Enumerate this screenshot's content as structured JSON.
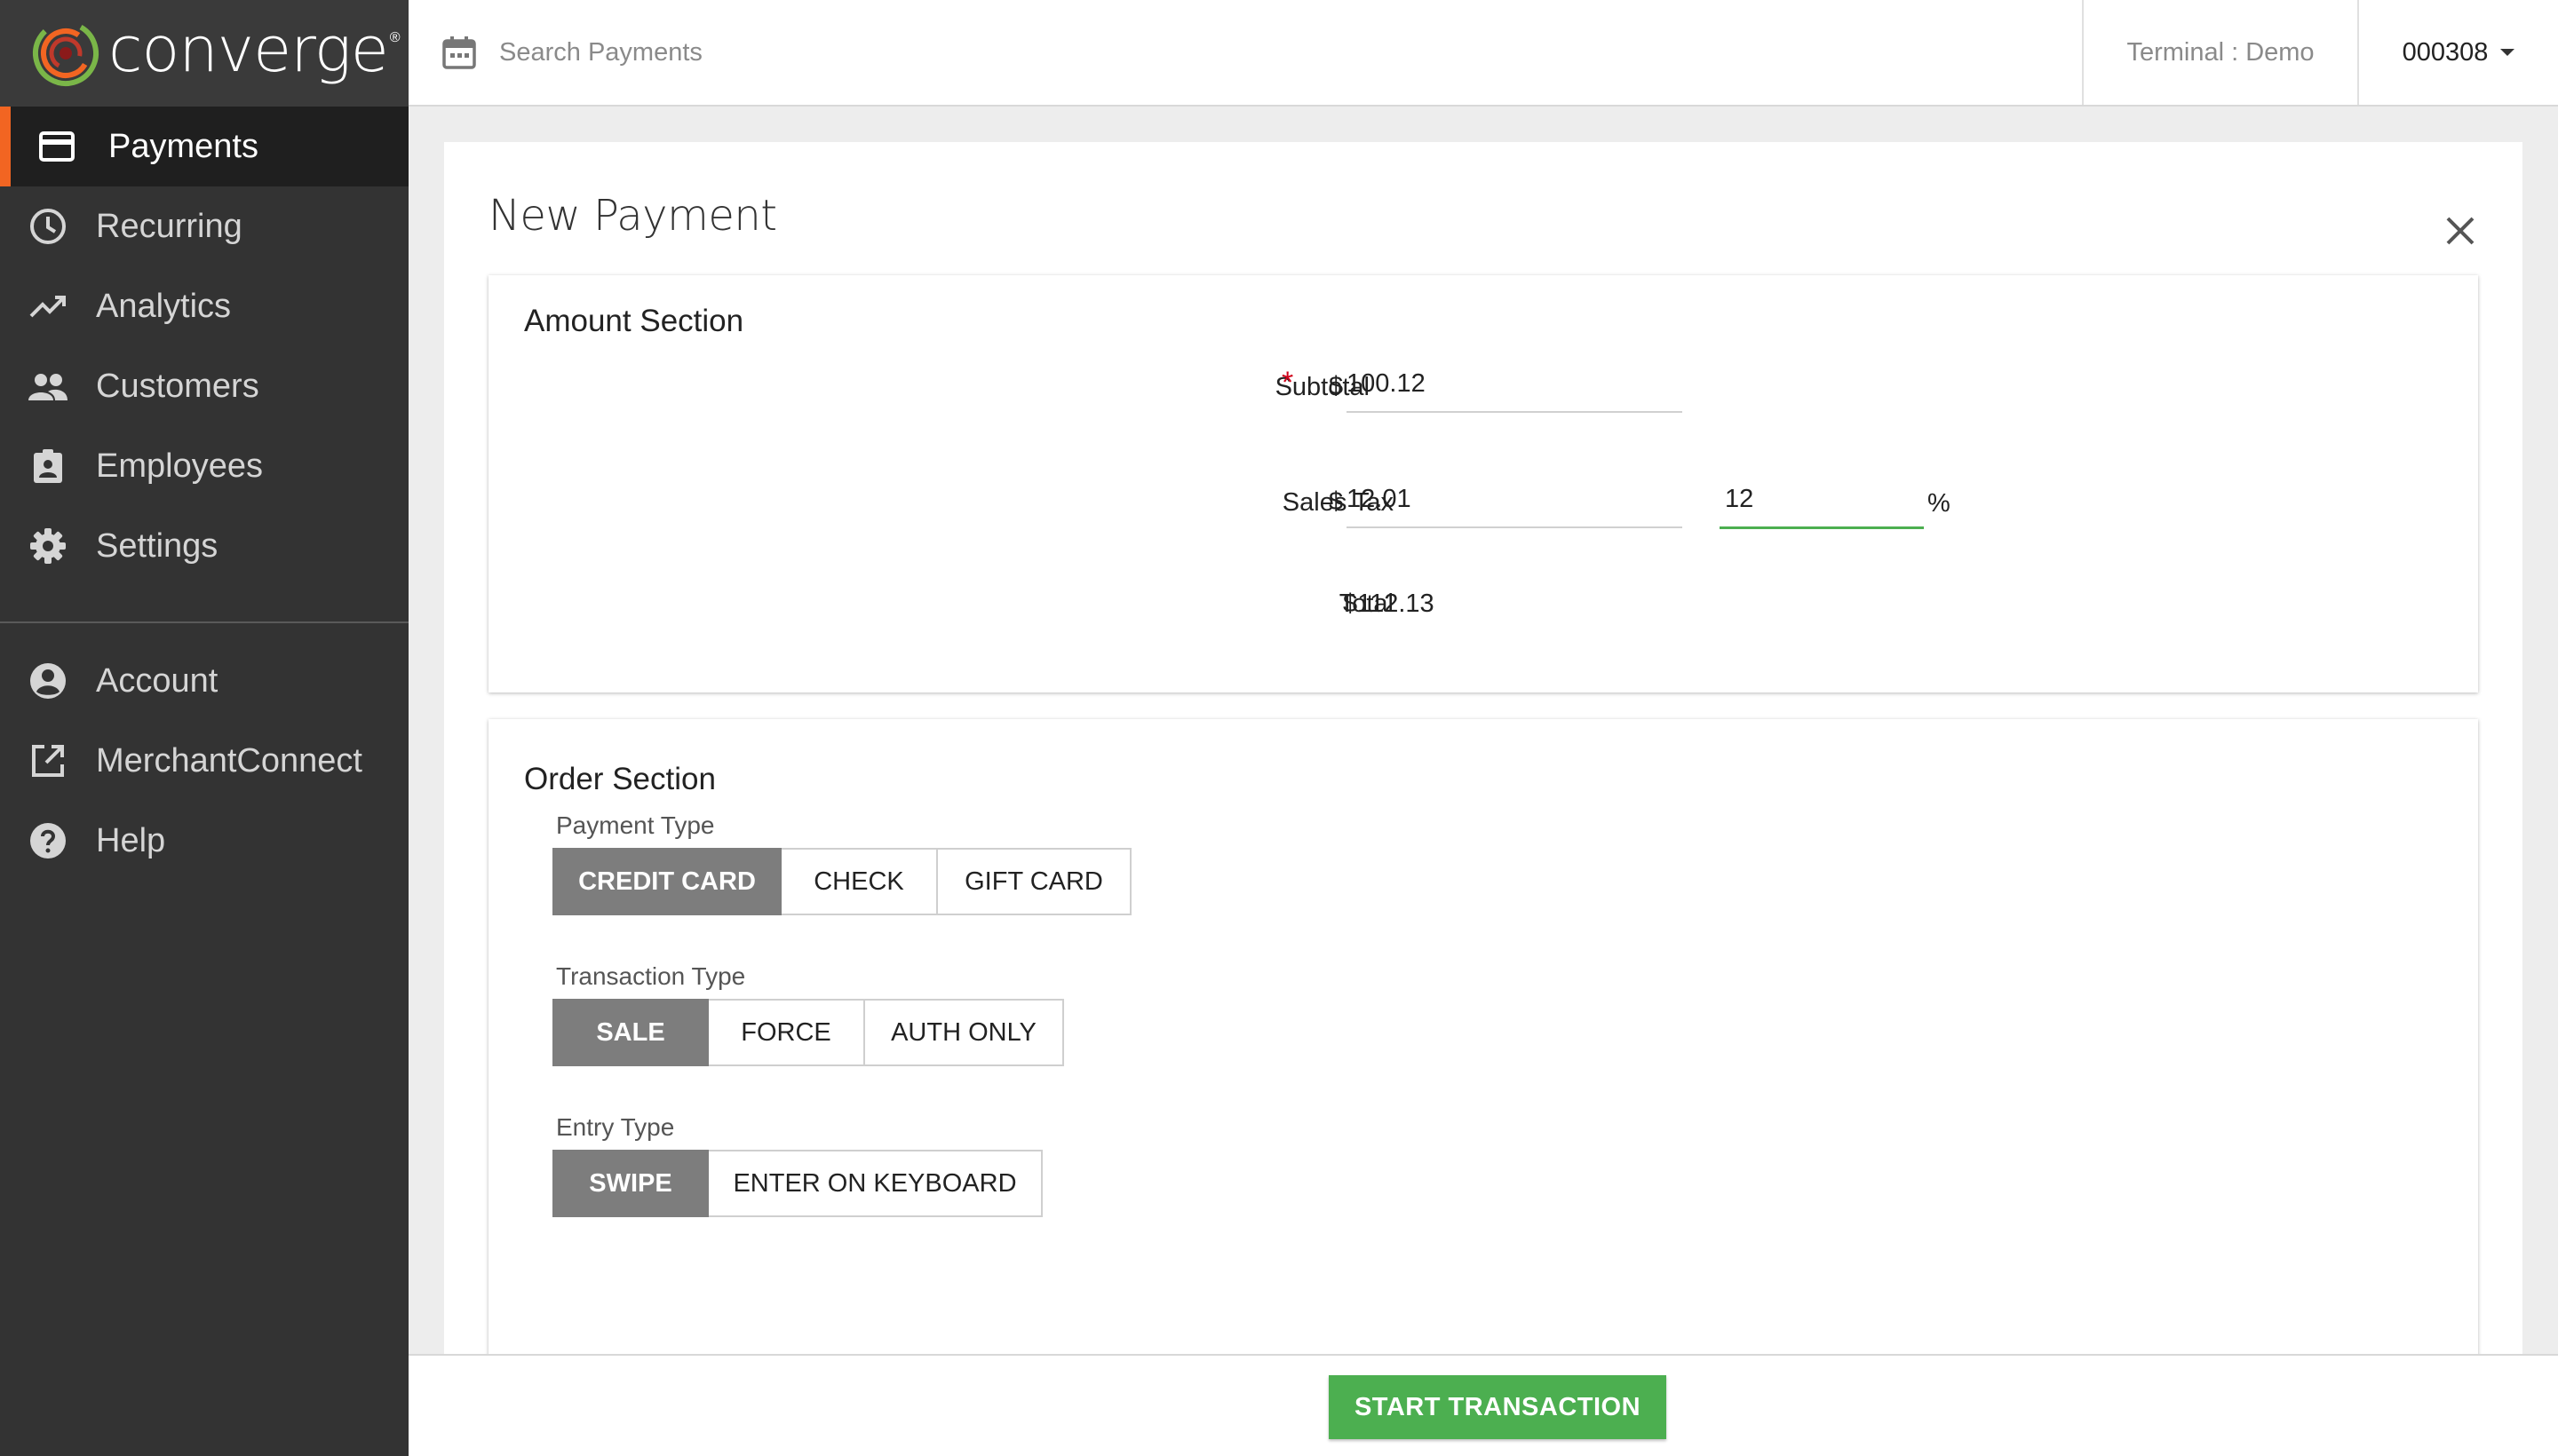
{
  "app": {
    "brand": "converge",
    "brand_mark": "®"
  },
  "sidebar": {
    "items": [
      {
        "label": "Payments",
        "icon": "credit-card-icon",
        "active": true
      },
      {
        "label": "Recurring",
        "icon": "clock-icon"
      },
      {
        "label": "Analytics",
        "icon": "trending-up-icon"
      },
      {
        "label": "Customers",
        "icon": "people-icon"
      },
      {
        "label": "Employees",
        "icon": "badge-icon"
      },
      {
        "label": "Settings",
        "icon": "gear-icon"
      }
    ],
    "secondary_items": [
      {
        "label": "Account",
        "icon": "account-circle-icon"
      },
      {
        "label": "MerchantConnect",
        "icon": "external-link-icon"
      },
      {
        "label": "Help",
        "icon": "help-circle-icon"
      }
    ]
  },
  "topbar": {
    "search_placeholder": "Search Payments",
    "terminal_label": "Terminal : Demo",
    "account_id": "000308"
  },
  "panel": {
    "title": "New Payment",
    "amount_section": {
      "title": "Amount Section",
      "subtotal_label": "Subtotal",
      "required_mark": "*",
      "currency_symbol": "$",
      "subtotal_value": "100.12",
      "sales_tax_label": "Sales Tax",
      "sales_tax_value": "12.01",
      "tax_percent_value": "12",
      "percent_symbol": "%",
      "total_label": "Total",
      "total_value": "$112.13"
    },
    "order_section": {
      "title": "Order Section",
      "payment_type": {
        "label": "Payment Type",
        "options": [
          "CREDIT CARD",
          "CHECK",
          "GIFT CARD"
        ],
        "selected": "CREDIT CARD"
      },
      "transaction_type": {
        "label": "Transaction Type",
        "options": [
          "SALE",
          "FORCE",
          "AUTH ONLY"
        ],
        "selected": "SALE"
      },
      "entry_type": {
        "label": "Entry Type",
        "options": [
          "SWIPE",
          "ENTER ON KEYBOARD"
        ],
        "selected": "SWIPE"
      }
    }
  },
  "footer": {
    "start_button": "START TRANSACTION"
  },
  "colors": {
    "accent_orange": "#f26522",
    "primary_green": "#4caf50",
    "sidebar_bg": "#333333",
    "selected_segment": "#7d7d7d"
  }
}
